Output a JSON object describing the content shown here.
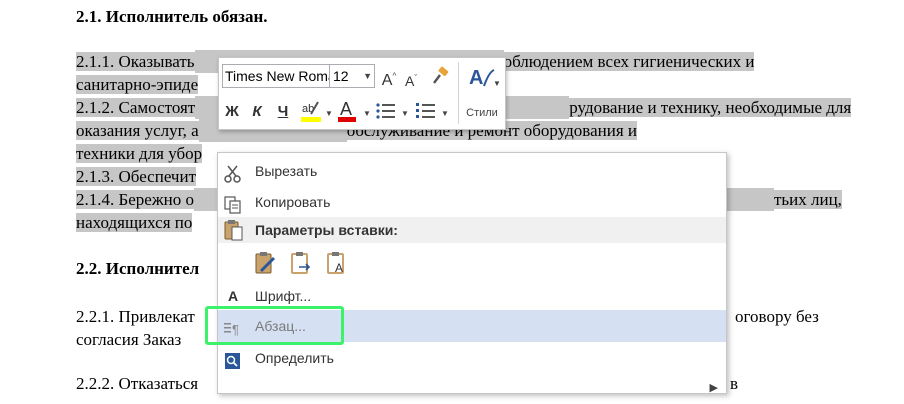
{
  "document": {
    "heading1": "2.1. Исполнитель обязан.",
    "p1_a": "2.1.1. Оказывать",
    "p1_b": "облюдением всех гигиенических и",
    "p1_c": "санитарно-эпиде",
    "p2_a": "2.1.2. Самостоят",
    "p2_b": "рудование и технику, необходимые для",
    "p2_c": "оказания услуг, а",
    "p2_d": "обслуживание и ремонт оборудования и",
    "p2_e": "техники для убор",
    "p3_a": "2.1.3. Обеспечит",
    "p4_a": "2.1.4. Бережно о",
    "p4_b": "тьих лиц,",
    "p4_c": "находящихся по",
    "heading2": "2.2. Исполнител",
    "p5_a": "2.2.1. Привлекат",
    "p5_b": "оговору без",
    "p5_c": "согласия Заказ",
    "p6_a": "2.2.2. Отказаться",
    "p6_b": "в"
  },
  "minitoolbar": {
    "font_name": "Times New Roman",
    "font_size": "12",
    "bold": "Ж",
    "italic": "К",
    "underline": "Ч",
    "styles_label": "Стили",
    "highlight_color": "#ffff00",
    "font_color": "#e00000"
  },
  "context_menu": {
    "cut": "Вырезать",
    "copy": "Копировать",
    "paste_options": "Параметры вставки:",
    "font": "Шрифт...",
    "paragraph": "Абзац...",
    "define": "Определить"
  }
}
